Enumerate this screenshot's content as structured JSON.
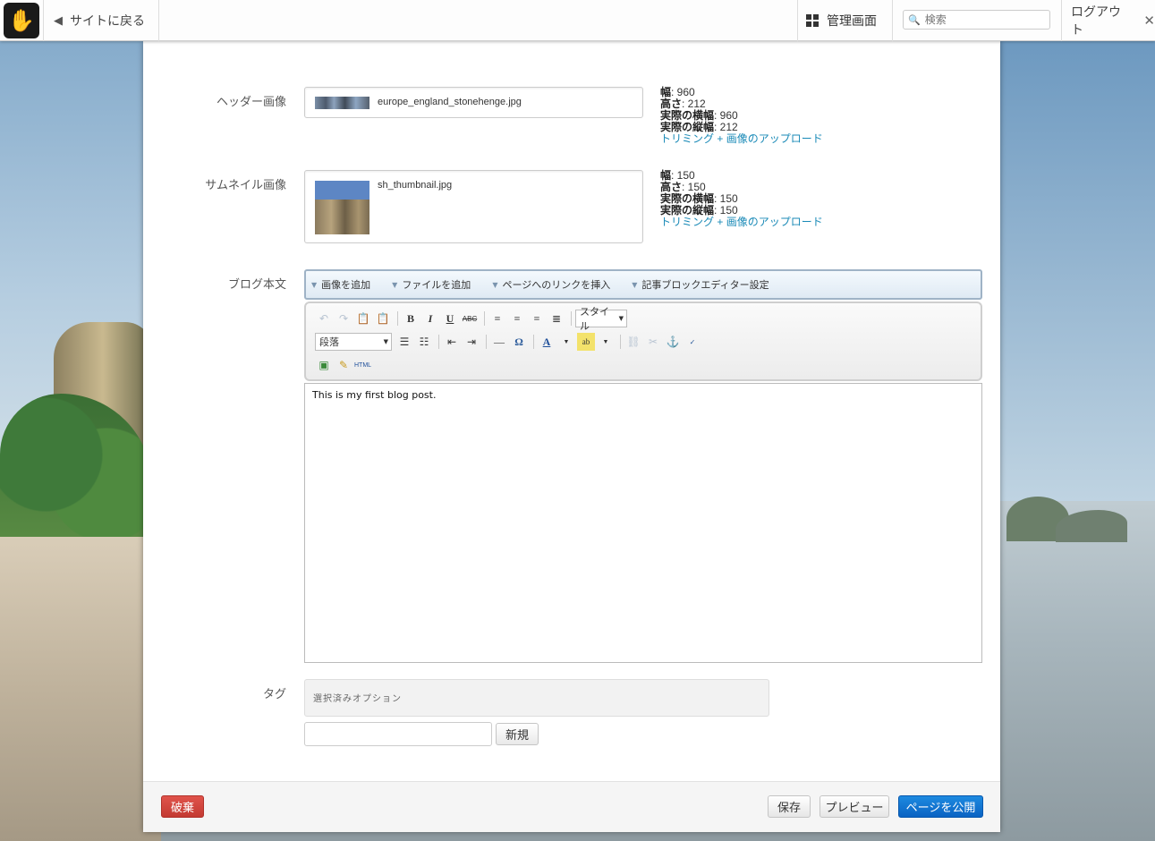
{
  "toolbar": {
    "back_label": "サイトに戻る",
    "dashboard_label": "管理画面",
    "search_placeholder": "検索",
    "logout_label": "ログアウト"
  },
  "fields": {
    "header_image": {
      "label": "ヘッダー画像",
      "filename": "europe_england_stonehenge.jpg",
      "meta": [
        {
          "key": "幅",
          "value": ": 960"
        },
        {
          "key": "高さ",
          "value": ": 212"
        },
        {
          "key": "実際の横幅",
          "value": ": 960"
        },
        {
          "key": "実際の縦幅",
          "value": ": 212"
        }
      ],
      "link_crop": "トリミング",
      "link_upload": "+ 画像のアップロード"
    },
    "thumbnail_image": {
      "label": "サムネイル画像",
      "filename": "sh_thumbnail.jpg",
      "meta": [
        {
          "key": "幅",
          "value": ": 150"
        },
        {
          "key": "高さ",
          "value": ": 150"
        },
        {
          "key": "実際の横幅",
          "value": ": 150"
        },
        {
          "key": "実際の縦幅",
          "value": ": 150"
        }
      ],
      "link_crop": "トリミング",
      "link_upload": "+ 画像のアップロード"
    },
    "body": {
      "label": "ブログ本文",
      "add_image": "画像を追加",
      "add_file": "ファイルを追加",
      "insert_link": "ページへのリンクを挿入",
      "editor_settings": "記事ブロックエディター設定",
      "style_select": "スタイル",
      "format_select": "段落",
      "html_button": "HTML",
      "content": "This is my first blog post."
    },
    "tags": {
      "label": "タグ",
      "selected_placeholder": "選択済みオプション",
      "new_button": "新規",
      "input_value": ""
    }
  },
  "footer": {
    "discard": "破棄",
    "save": "保存",
    "preview": "プレビュー",
    "publish": "ページを公開"
  }
}
